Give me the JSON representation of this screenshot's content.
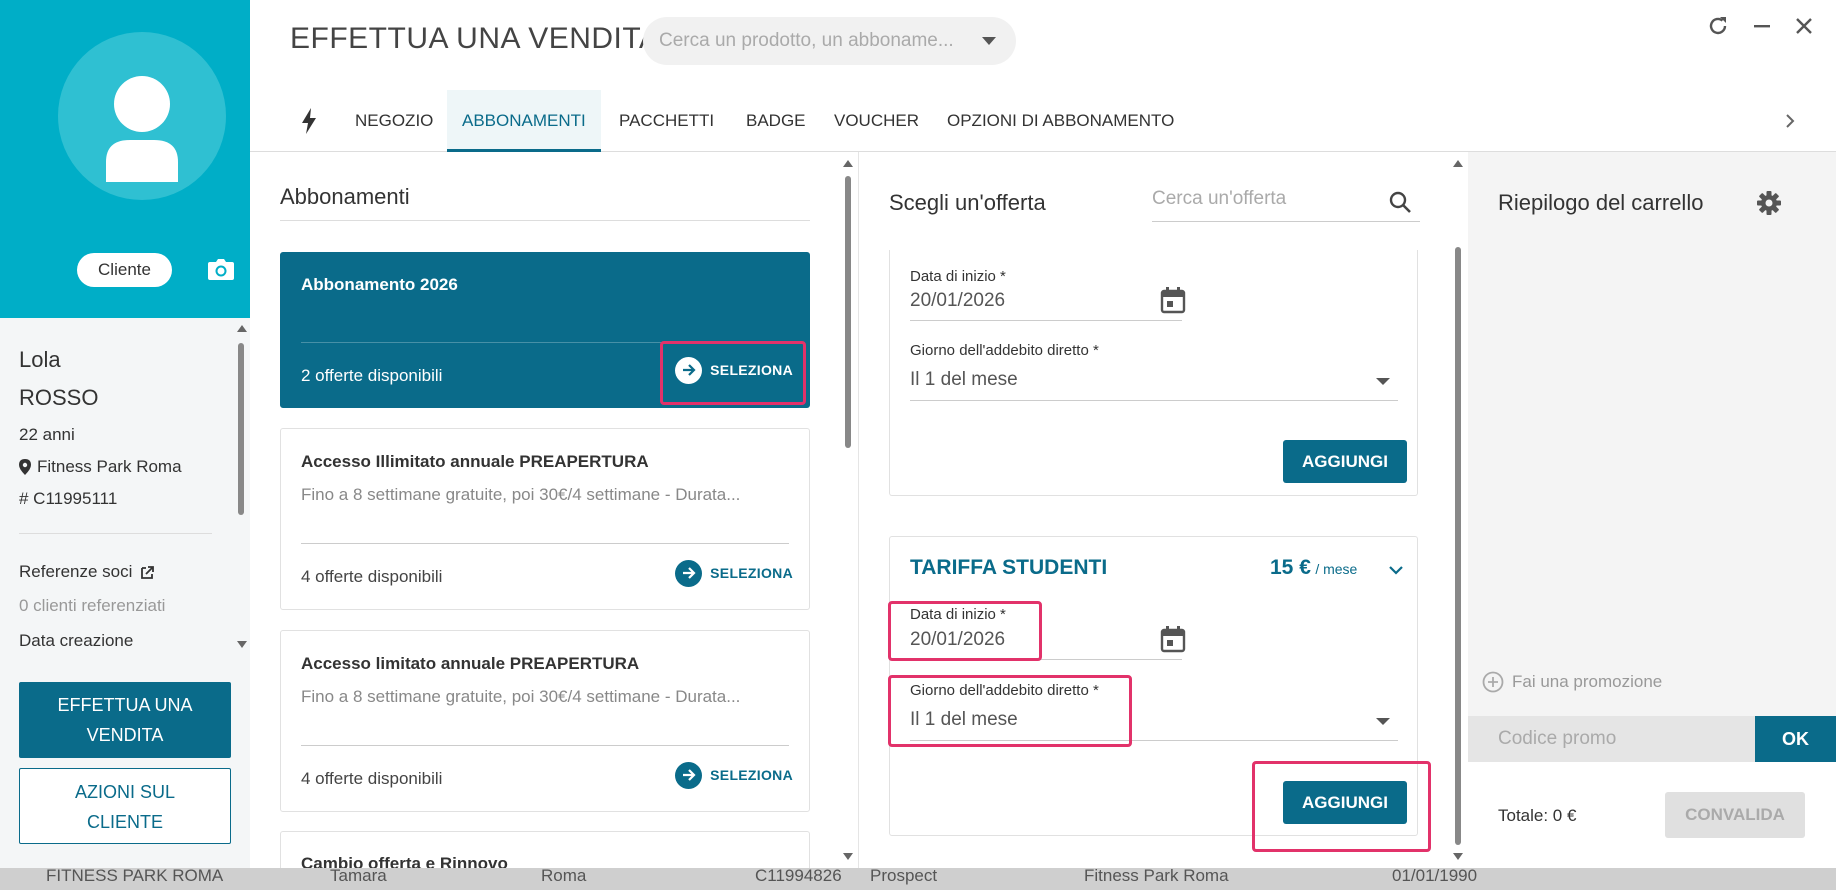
{
  "background_table": {
    "cells": [
      "FITNESS PARK ROMA",
      "Tamara",
      "Roma",
      "C11994826",
      "Prospect",
      "Fitness Park Roma",
      "01/01/1990"
    ]
  },
  "client": {
    "badge": "Cliente",
    "first_name": "Lola",
    "last_name": "ROSSO",
    "age": "22 anni",
    "club": "Fitness Park Roma",
    "id": "# C11995111",
    "referrals_label": "Referenze soci",
    "referrals_value": "0 clienti referenziati",
    "creation_label": "Data creazione",
    "primary_button": "EFFETTUA UNA VENDITA",
    "secondary_button": "AZIONI SUL CLIENTE"
  },
  "header": {
    "title": "EFFETTUA UNA VENDITA",
    "search_placeholder": "Cerca un prodotto, un abboname..."
  },
  "tabs": [
    "NEGOZIO",
    "ABBONAMENTI",
    "PACCHETTI",
    "BADGE",
    "VOUCHER",
    "OPZIONI DI ABBONAMENTO"
  ],
  "active_tab": "ABBONAMENTI",
  "subscriptions": {
    "title": "Abbonamenti",
    "select_label": "SELEZIONA",
    "items": [
      {
        "name": "Abbonamento 2026",
        "desc": "",
        "available": "2 offerte disponibili",
        "selected": true
      },
      {
        "name": "Accesso Illimitato annuale PREAPERTURA",
        "desc": "Fino a 8 settimane gratuite, poi 30€/4 settimane - Durata...",
        "available": "4 offerte disponibili"
      },
      {
        "name": "Accesso limitato annuale PREAPERTURA",
        "desc": "Fino a 8 settimane gratuite, poi 30€/4 settimane - Durata...",
        "available": "4 offerte disponibili"
      },
      {
        "name": "Cambio offerta e Rinnovo"
      }
    ]
  },
  "offers": {
    "title": "Scegli un'offerta",
    "search_placeholder": "Cerca un'offerta",
    "start_date_label": "Data di inizio *",
    "debit_day_label": "Giorno dell'addebito diretto *",
    "add_label": "AGGIUNGI",
    "card1": {
      "start_date": "20/01/2026",
      "debit_day": "Il 1 del mese"
    },
    "card2": {
      "name": "TARIFFA STUDENTI",
      "price": "15 €",
      "period": "/ mese",
      "start_date": "20/01/2026",
      "debit_day": "Il 1 del mese"
    }
  },
  "cart": {
    "title": "Riepilogo del carrello",
    "promo_link": "Fai una promozione",
    "promo_placeholder": "Codice promo",
    "ok_label": "OK",
    "total": "Totale: 0 €",
    "validate_label": "CONVALIDA"
  },
  "colors": {
    "accent": "#0a6b8a",
    "cyan": "#00aec7",
    "highlight": "#e2326a"
  }
}
